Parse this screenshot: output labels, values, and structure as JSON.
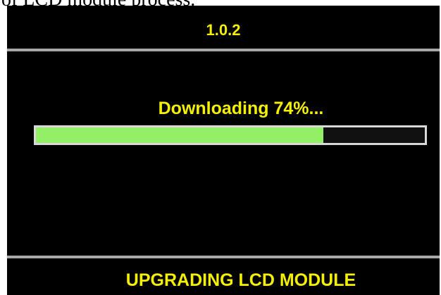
{
  "caption_fragment": "of LCD module process.",
  "screen": {
    "version": "1.0.2",
    "status_text": "Downloading 74%...",
    "progress": 0.74,
    "footer_title": "UPGRADING LCD MODULE"
  },
  "colors": {
    "text": "#f4f000",
    "background": "#000000",
    "progress_fill": "#93f066",
    "divider": "#a8a8a8"
  }
}
